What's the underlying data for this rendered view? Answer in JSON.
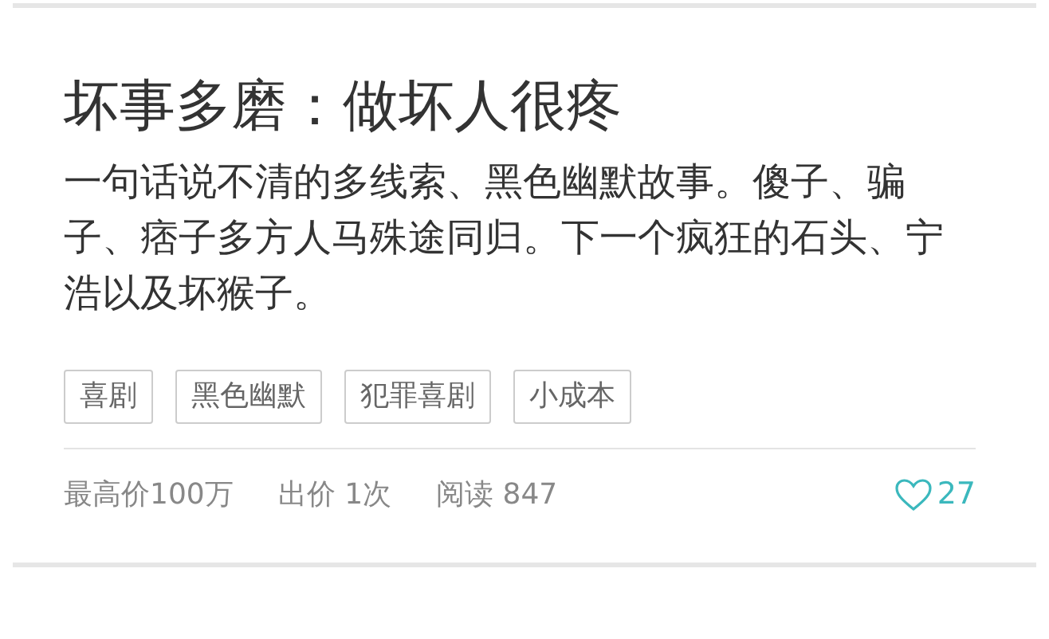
{
  "card": {
    "title": "坏事多磨：做坏人很疼",
    "description": "一句话说不清的多线索、黑色幽默故事。傻子、骗子、痞子多方人马殊途同归。下一个疯狂的石头、宁浩以及坏猴子。",
    "tags": [
      "喜剧",
      "黑色幽默",
      "犯罪喜剧",
      "小成本"
    ],
    "stats": [
      "最高价100万",
      "出价 1次",
      "阅读 847"
    ],
    "likes": "27"
  }
}
